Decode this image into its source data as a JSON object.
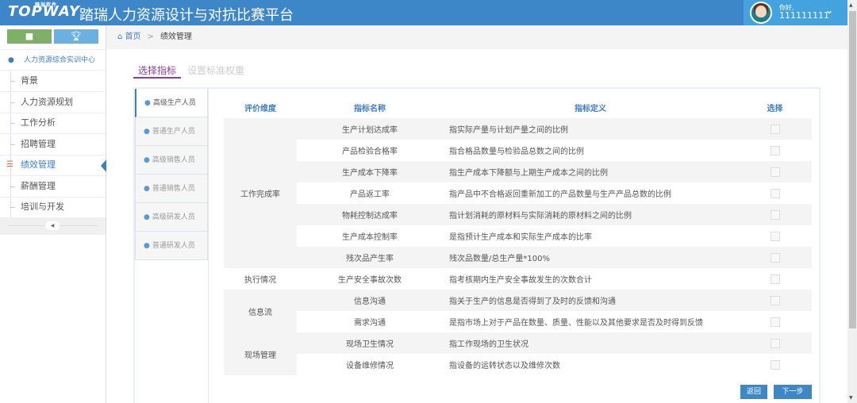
{
  "header": {
    "logo": "TOPWAY",
    "logo_sub": "踏瑞软件",
    "title": "踏瑞人力资源设计与对抗比赛平台",
    "greeting": "你好,",
    "username": "111111111",
    "colors": {
      "bar": "#3d87c8",
      "user": "#44a3df"
    }
  },
  "sidebar": {
    "heading": "人力资源综合实训中心",
    "items": [
      {
        "label": "背景"
      },
      {
        "label": "人力资源规划"
      },
      {
        "label": "工作分析"
      },
      {
        "label": "招聘管理"
      },
      {
        "label": "绩效管理",
        "active": true
      },
      {
        "label": "薪酬管理"
      },
      {
        "label": "培训与开发"
      }
    ]
  },
  "breadcrumb": {
    "home": "首页",
    "current": "绩效管理"
  },
  "tabs": [
    {
      "label": "选择指标",
      "active": true
    },
    {
      "label": "设置标准权重",
      "active": false
    }
  ],
  "roles": [
    {
      "label": "高级生产人员",
      "active": true
    },
    {
      "label": "普通生产人员"
    },
    {
      "label": "高级销售人员"
    },
    {
      "label": "普通销售人员"
    },
    {
      "label": "高级研发人员"
    },
    {
      "label": "普通研发人员"
    }
  ],
  "table": {
    "headers": [
      "评价维度",
      "指标名称",
      "指标定义",
      "选择"
    ],
    "groups": [
      {
        "dimension": "工作完成率",
        "rows": [
          {
            "name": "生产计划达成率",
            "def": "指实际产量与计划产量之间的比例",
            "checked": false
          },
          {
            "name": "产品检验合格率",
            "def": "指合格品数量与检验品总数之间的比例",
            "checked": false
          },
          {
            "name": "生产成本下降率",
            "def": "指生产成本下降额与上期生产成本之间的比例",
            "checked": false
          },
          {
            "name": "产品返工率",
            "def": "指产品中不合格返回重新加工的产品数量与生产产品总数的比例",
            "checked": false
          },
          {
            "name": "物耗控制达成率",
            "def": "指计划消耗的原材料与实际消耗的原材料之间的比例",
            "checked": false
          },
          {
            "name": "生产成本控制率",
            "def": "是指预计生产成本和实际生产成本的比率",
            "checked": false
          },
          {
            "name": "残次品产生率",
            "def": "残次品数量/总生产量*100%",
            "checked": false
          }
        ]
      },
      {
        "dimension": "执行情况",
        "rows": [
          {
            "name": "生产安全事故次数",
            "def": "指考核期内生产安全事故发生的次数合计",
            "checked": false
          }
        ]
      },
      {
        "dimension": "信息流",
        "rows": [
          {
            "name": "信息沟通",
            "def": "指关于生产的信息是否得到了及时的反馈和沟通",
            "checked": false
          },
          {
            "name": "需求沟通",
            "def": "是指市场上对于产品在数量、质量、性能以及其他要求是否及时得到反馈",
            "checked": false
          }
        ]
      },
      {
        "dimension": "现场管理",
        "rows": [
          {
            "name": "现场卫生情况",
            "def": "指工作现场的卫生状况",
            "checked": false
          },
          {
            "name": "设备维修情况",
            "def": "指设备的运转状态以及维修次数",
            "checked": false
          }
        ]
      }
    ]
  },
  "buttons": {
    "back": "返回",
    "next": "下一步"
  }
}
